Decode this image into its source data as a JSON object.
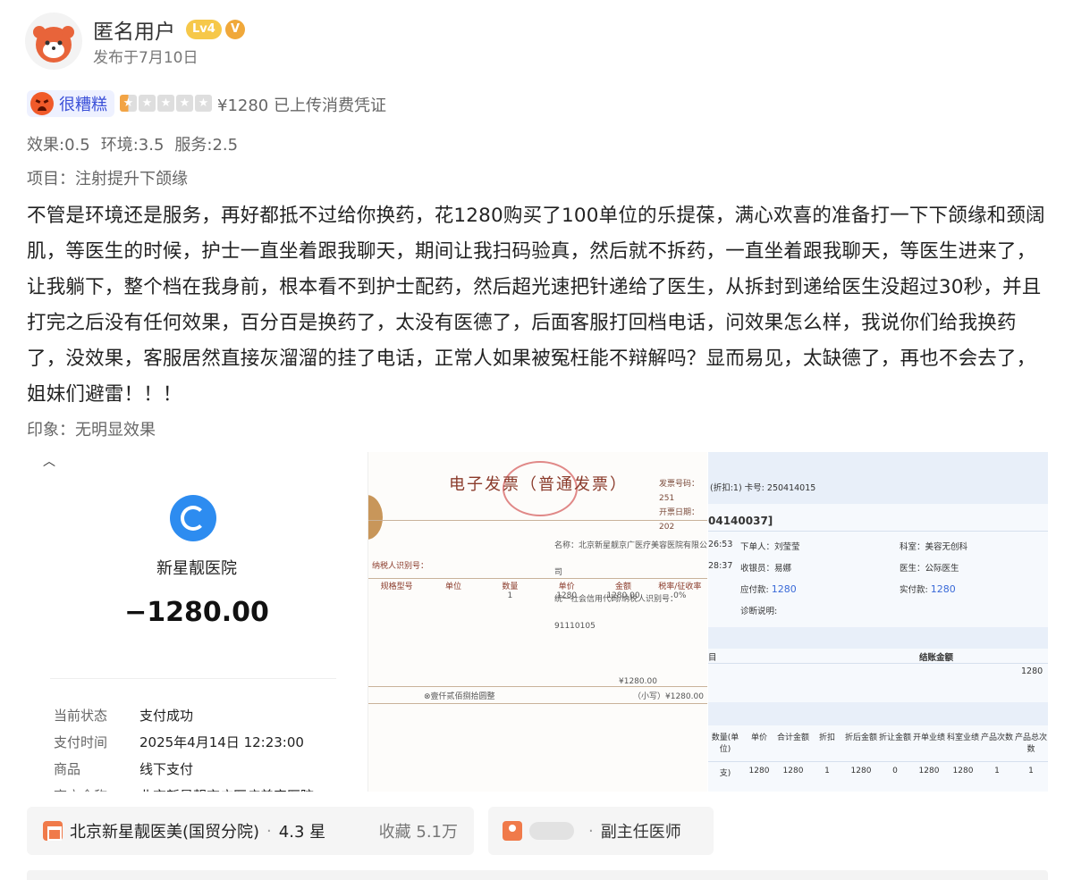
{
  "user": {
    "name": "匿名用户",
    "level": "Lv4",
    "verified_mark": "V",
    "post_date": "发布于7月10日",
    "avatar_icon": "red-panda-avatar-icon"
  },
  "rating": {
    "label": "很糟糕",
    "stars_value": 0.5,
    "stars_max": 5,
    "price_note": "¥1280 已上传消费凭证"
  },
  "scores": {
    "effect": "效果:0.5",
    "environment": "环境:3.5",
    "service": "服务:2.5"
  },
  "project": "项目：注射提升下颌缘",
  "review_text": "不管是环境还是服务，再好都抵不过给你换药，花1280购买了100单位的乐提葆，满心欢喜的准备打一下下颌缘和颈阔肌，等医生的时候，护士一直坐着跟我聊天，期间让我扫码验真，然后就不拆药，一直坐着跟我聊天，等医生进来了，让我躺下，整个档在我身前，根本看不到护士配药，然后超光速把针递给了医生，从拆封到递给医生没超过30秒，并且打完之后没有任何效果，百分百是换药了，太没有医德了，后面客服打回档电话，问效果怎么样，我说你们给我换药了，没效果，客服居然直接灰溜溜的挂了电话，正常人如果被冤枉能不辩解吗？显而易见，太缺德了，再也不会去了，姐妹们避雷！！！",
  "impression": "印象：无明显效果",
  "payment": {
    "merchant": "新星靓医院",
    "amount": "−1280.00",
    "rows": [
      {
        "k": "当前状态",
        "v": "支付成功"
      },
      {
        "k": "支付时间",
        "v": "2025年4月14日 12:23:00"
      },
      {
        "k": "商品",
        "v": "线下支付"
      },
      {
        "k": "商户全称",
        "v": "北京新星靓京广医疗美容医院"
      }
    ]
  },
  "invoice": {
    "title": "电子发票（普通发票）",
    "meta_no": "发票号码：251",
    "meta_date": "开票日期：202",
    "seller_name": "名称：北京新星靓京广医疗美容医院有限公司",
    "seller_id": "统一社会信用代码/纳税人识别号：91110105",
    "buyer_label": "纳税人识别号：",
    "heads": [
      "规格型号",
      "单位",
      "数量",
      "单价",
      "金额",
      "税率/征收率"
    ],
    "vals": [
      "",
      "",
      "1",
      "1280",
      "1280.00",
      "0%"
    ],
    "total": "¥1280.00",
    "caps": "⊗壹仟贰佰捌拾圆整",
    "small_total": "（小写）¥1280.00"
  },
  "receipt": {
    "discount_card": "(折扣:1) 卡号: 250414015",
    "order_no": "04140037]",
    "t1": "26:53",
    "t2": "28:37",
    "orderer": "下单人：刘莹莹",
    "cashier": "收银员：易娜",
    "payable_label": "应付款:",
    "payable": "1280",
    "note_label": "诊断说明:",
    "dept": "科室：美容无创科",
    "doctor": "医生：公际医生",
    "paid_label": "实付款:",
    "paid": "1280",
    "items_label": "目",
    "settle_label": "结账金额",
    "settle_value": "1280",
    "table_heads": [
      "数量(单位)",
      "单价",
      "合计金额",
      "折扣",
      "折后金额",
      "折让金额",
      "开单业绩",
      "科室业绩",
      "产品次数",
      "产品总次数"
    ],
    "table_row": [
      "支)",
      "1280",
      "1280",
      "1",
      "1280",
      "0",
      "1280",
      "1280",
      "1",
      "1"
    ]
  },
  "chips": {
    "clinic_name": "北京新星靓医美(国贸分院)",
    "clinic_rating": "4.3 星",
    "clinic_favs": "收藏 5.1万",
    "doctor_title": "副主任医师"
  },
  "colors": {
    "rating_label": "#3a4fd8",
    "star_fill": "#f2a445",
    "level_badge": "#f6c84a",
    "pay_logo": "#2d8cf0"
  }
}
